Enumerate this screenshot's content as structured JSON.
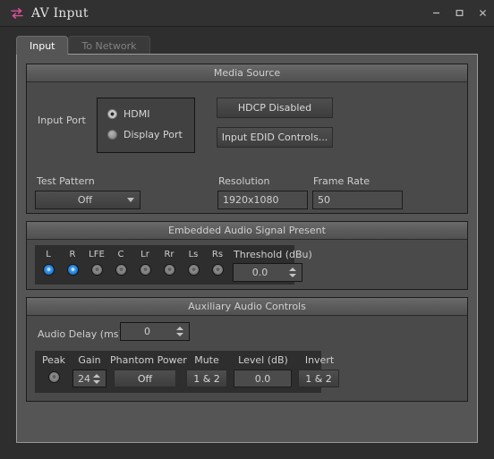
{
  "window": {
    "title": "AV Input",
    "icon": "transfer-arrows-icon",
    "icon_color": "#e0519b",
    "minimize_label": "–",
    "maximize_label": "□",
    "close_label": "✕"
  },
  "tabs": [
    {
      "label": "Input",
      "active": true
    },
    {
      "label": "To Network",
      "active": false
    }
  ],
  "groups": {
    "media_source": {
      "title": "Media Source",
      "input_port_label": "Input Port",
      "radios": [
        {
          "label": "HDMI",
          "selected": true
        },
        {
          "label": "Display Port",
          "selected": false
        }
      ],
      "hdcp_button": "HDCP Disabled",
      "edid_button": "Input EDID Controls...",
      "test_pattern_label": "Test Pattern",
      "test_pattern_value": "Off",
      "resolution_label": "Resolution",
      "resolution_value": "1920x1080",
      "frame_rate_label": "Frame Rate",
      "frame_rate_value": "50"
    },
    "embedded_audio": {
      "title": "Embedded Audio Signal Present",
      "channels": [
        {
          "name": "L",
          "on": true
        },
        {
          "name": "R",
          "on": true
        },
        {
          "name": "LFE",
          "on": false
        },
        {
          "name": "C",
          "on": false
        },
        {
          "name": "Lr",
          "on": false
        },
        {
          "name": "Rr",
          "on": false
        },
        {
          "name": "Ls",
          "on": false
        },
        {
          "name": "Rs",
          "on": false
        }
      ],
      "threshold_label": "Threshold (dBu)",
      "threshold_value": "0.0"
    },
    "aux_audio": {
      "title": "Auxiliary Audio Controls",
      "audio_delay_label": "Audio Delay (ms)",
      "audio_delay_value": "0",
      "columns": {
        "peak_label": "Peak",
        "gain_label": "Gain",
        "gain_value": "24",
        "phantom_label": "Phantom Power",
        "phantom_value": "Off",
        "mute_label": "Mute",
        "mute_value": "1 & 2",
        "level_label": "Level (dB)",
        "level_value": "0.0",
        "invert_label": "Invert",
        "invert_value": "1 & 2"
      }
    }
  },
  "colors": {
    "accent": "#e0519b",
    "led_on": "#3d9ded",
    "window_bg": "#2e2e2e",
    "panel_bg": "#555555",
    "group_bg": "#4a4a4a"
  }
}
